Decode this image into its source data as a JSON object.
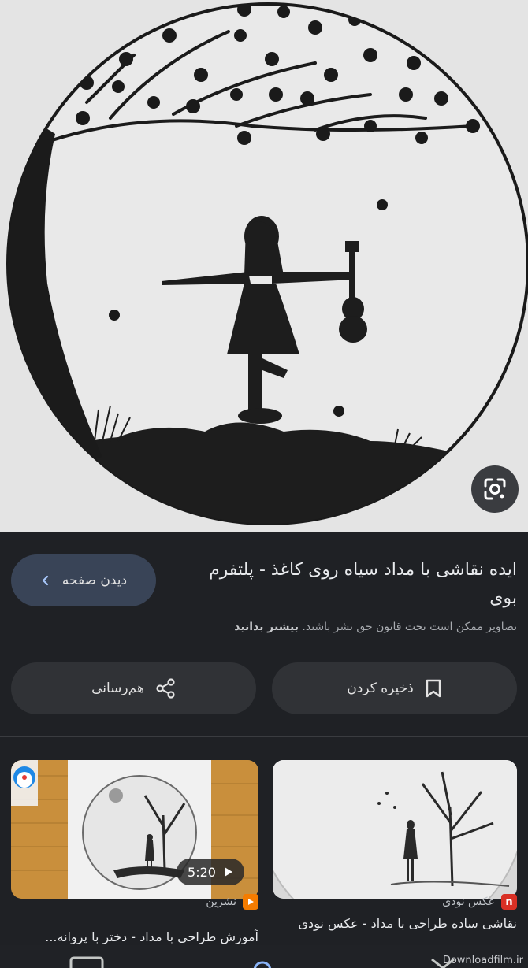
{
  "viewer": {
    "lens_icon": "google-lens-icon"
  },
  "result": {
    "visit_button_label": "دیدن صفحه",
    "title": "ایده نقاشی با مداد سیاه روی کاغذ - پلتفرم بوی",
    "copyright_notice": "تصاویر ممکن است تحت قانون حق نشر باشند.",
    "learn_more": "بیشتر بدانید",
    "save_label": "ذخیره کردن",
    "share_label": "هم‌رسانی"
  },
  "related": [
    {
      "source": "عکس نودی",
      "source_badge": "n",
      "source_color": "#d93025",
      "title": "نقاشی ساده طراحی با مداد - عکس نودی"
    },
    {
      "source": "نشرین",
      "source_color": "#f57c00",
      "duration": "5:20",
      "title": "آموزش طراحی با مداد - دختر با پروانه..."
    }
  ],
  "watermark": "Downloadfilm.ir"
}
